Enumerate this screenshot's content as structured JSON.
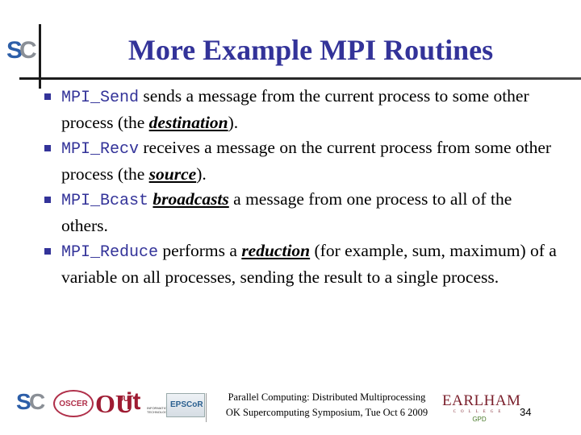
{
  "slide": {
    "title": "More Example MPI Routines",
    "accent_color": "#333399",
    "bullets": [
      {
        "code": "MPI_Send",
        "text_before": " sends a message from the current process to some other process (the ",
        "term": "destination",
        "text_after": ")."
      },
      {
        "code": "MPI_Recv",
        "text_before": " receives a message on the current process from some other process (the ",
        "term": "source",
        "text_after": ")."
      },
      {
        "code": "MPI_Bcast",
        "text_before": " ",
        "term": "broadcasts",
        "text_after": " a message from one process to all of the others."
      },
      {
        "code": "MPI_Reduce",
        "text_before": " performs a ",
        "term": "reduction",
        "text_after": " (for example, sum, maximum) of a variable on all processes, sending the result to a single process."
      }
    ]
  },
  "header_logo": {
    "icon": "supercomputing-logo",
    "s": "S",
    "c": "C"
  },
  "footer": {
    "line1": "Parallel Computing: Distributed Multiprocessing",
    "line2": "OK Supercomputing Symposium, Tue Oct 6 2009",
    "page_number": "34",
    "logos": {
      "sc": {
        "s": "S",
        "c": "C"
      },
      "oscer": "OSCER",
      "ou": "OU",
      "it_small": "OU",
      "it": "it",
      "it_sub": "INFORMATION TECHNOLOGY",
      "epscor": "EPSCoR",
      "earlham_name": "EARLHAM",
      "earlham_college": "COLLEGE",
      "gpd": "GPD"
    }
  }
}
